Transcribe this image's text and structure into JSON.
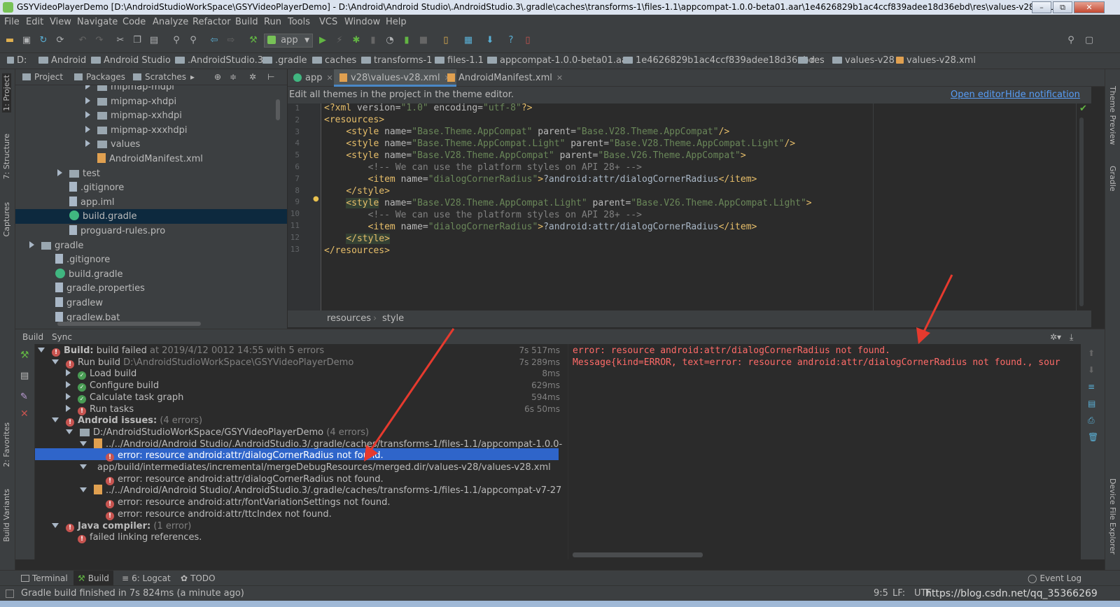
{
  "window": {
    "title": "GSYVideoPlayerDemo [D:\\AndroidStudioWorkSpace\\GSYVideoPlayerDemo] - D:\\Android\\Android Studio\\.AndroidStudio.3\\.gradle\\caches\\transforms-1\\files-1.1\\appcompat-1.0.0-beta01.aar\\1e4626829b1ac4ccf839adee18d36ebd\\res\\values-v28\\values...",
    "minimize": "–",
    "maximize": "⧉",
    "close": "✕"
  },
  "menu": [
    "File",
    "Edit",
    "View",
    "Navigate",
    "Code",
    "Analyze",
    "Refactor",
    "Build",
    "Run",
    "Tools",
    "VCS",
    "Window",
    "Help"
  ],
  "toolbar": {
    "run_config": "app"
  },
  "breadcrumb": [
    "D:",
    "Android",
    "Android Studio",
    ".AndroidStudio.3",
    ".gradle",
    "caches",
    "transforms-1",
    "files-1.1",
    "appcompat-1.0.0-beta01.aar",
    "1e4626829b1ac4ccf839adee18d36ebd",
    "res",
    "values-v28",
    "values-v28.xml"
  ],
  "left_strip": [
    "1: Project",
    "7: Structure",
    "Captures",
    "2: Favorites",
    "Build Variants"
  ],
  "right_strip": [
    "Theme Preview",
    "Gradle",
    "Device File Explorer"
  ],
  "project_panel": {
    "tabs": [
      "Project",
      "Packages",
      "Scratches"
    ],
    "tree": [
      {
        "label": "mipmap-mdpi",
        "indent": 5,
        "kind": "folder",
        "arrow": true
      },
      {
        "label": "mipmap-xhdpi",
        "indent": 5,
        "kind": "folder",
        "arrow": true
      },
      {
        "label": "mipmap-xxhdpi",
        "indent": 5,
        "kind": "folder",
        "arrow": true
      },
      {
        "label": "mipmap-xxxhdpi",
        "indent": 5,
        "kind": "folder",
        "arrow": true
      },
      {
        "label": "values",
        "indent": 5,
        "kind": "folder",
        "arrow": true
      },
      {
        "label": "AndroidManifest.xml",
        "indent": 5,
        "kind": "xml",
        "arrow": false
      },
      {
        "label": "test",
        "indent": 3,
        "kind": "folder",
        "arrow": true
      },
      {
        "label": ".gitignore",
        "indent": 3,
        "kind": "file",
        "arrow": false
      },
      {
        "label": "app.iml",
        "indent": 3,
        "kind": "file",
        "arrow": false
      },
      {
        "label": "build.gradle",
        "indent": 3,
        "kind": "gradle",
        "arrow": false
      },
      {
        "label": "proguard-rules.pro",
        "indent": 3,
        "kind": "file",
        "arrow": false
      },
      {
        "label": "gradle",
        "indent": 1,
        "kind": "folder",
        "arrow": true
      },
      {
        "label": ".gitignore",
        "indent": 2,
        "kind": "file",
        "arrow": false
      },
      {
        "label": "build.gradle",
        "indent": 2,
        "kind": "gradle",
        "arrow": false
      },
      {
        "label": "gradle.properties",
        "indent": 2,
        "kind": "file",
        "arrow": false
      },
      {
        "label": "gradlew",
        "indent": 2,
        "kind": "file",
        "arrow": false
      },
      {
        "label": "gradlew.bat",
        "indent": 2,
        "kind": "file",
        "arrow": false
      }
    ],
    "selected_index": 9
  },
  "editor": {
    "tabs": [
      {
        "label": "app",
        "active": false
      },
      {
        "label": "v28\\values-v28.xml",
        "active": true
      },
      {
        "label": "AndroidManifest.xml",
        "active": false
      }
    ],
    "notification": "Edit all themes in the project in the theme editor.",
    "open_editor": "Open editor",
    "hide_notification": "Hide notification",
    "line_numbers": [
      "1",
      "2",
      "3",
      "4",
      "5",
      "6",
      "7",
      "8",
      "9",
      "10",
      "11",
      "12",
      "13"
    ],
    "breadcrumb": [
      "resources",
      "style"
    ]
  },
  "build_panel": {
    "tabs": [
      "Build",
      "Sync"
    ],
    "rows": [
      {
        "text": "Build:",
        "extra": " build failed",
        "note": "  at 2019/4/12 0012 14:55   with 5 errors",
        "dur": "7s 517ms",
        "indent": 0,
        "icon": "err",
        "tri": "down",
        "bold": true
      },
      {
        "text": "Run build",
        "extra": "",
        "note": " D:\\AndroidStudioWorkSpace\\GSYVideoPlayerDemo",
        "dur": "7s 289ms",
        "indent": 1,
        "icon": "err",
        "tri": "down",
        "bold": false
      },
      {
        "text": "Load build",
        "extra": "",
        "note": "",
        "dur": "8ms",
        "indent": 2,
        "icon": "ok",
        "tri": "right",
        "bold": false
      },
      {
        "text": "Configure build",
        "extra": "",
        "note": "",
        "dur": "629ms",
        "indent": 2,
        "icon": "ok",
        "tri": "right",
        "bold": false
      },
      {
        "text": "Calculate task graph",
        "extra": "",
        "note": "",
        "dur": "594ms",
        "indent": 2,
        "icon": "ok",
        "tri": "right",
        "bold": false
      },
      {
        "text": "Run tasks",
        "extra": "",
        "note": "",
        "dur": "6s 50ms",
        "indent": 2,
        "icon": "err",
        "tri": "right",
        "bold": false
      },
      {
        "text": "Android issues:",
        "extra": "",
        "note": "  (4 errors)",
        "dur": "",
        "indent": 1,
        "icon": "err",
        "tri": "down",
        "bold": true
      },
      {
        "text": "D:/AndroidStudioWorkSpace/GSYVideoPlayerDemo",
        "extra": "",
        "note": "  (4 errors)",
        "dur": "",
        "indent": 2,
        "icon": "folder",
        "tri": "down",
        "bold": false
      },
      {
        "text": "../../Android/Android Studio/.AndroidStudio.3/.gradle/caches/transforms-1/files-1.1/appcompat-1.0.0-",
        "extra": "",
        "note": "",
        "dur": "",
        "indent": 3,
        "icon": "file",
        "tri": "down",
        "bold": false
      },
      {
        "text": "error: resource android:attr/dialogCornerRadius not found.",
        "extra": "",
        "note": "",
        "dur": "",
        "indent": 4,
        "icon": "err",
        "tri": "none",
        "bold": false
      },
      {
        "text": "app/build/intermediates/incremental/mergeDebugResources/merged.dir/values-v28/values-v28.xml",
        "extra": "",
        "note": "",
        "dur": "",
        "indent": 3,
        "icon": "none",
        "tri": "down",
        "bold": false
      },
      {
        "text": "error: resource android:attr/dialogCornerRadius not found.",
        "extra": "",
        "note": "",
        "dur": "",
        "indent": 4,
        "icon": "err",
        "tri": "none",
        "bold": false
      },
      {
        "text": "../../Android/Android Studio/.AndroidStudio.3/.gradle/caches/transforms-1/files-1.1/appcompat-v7-27",
        "extra": "",
        "note": "",
        "dur": "",
        "indent": 3,
        "icon": "file",
        "tri": "down",
        "bold": false
      },
      {
        "text": "error: resource android:attr/fontVariationSettings not found.",
        "extra": "",
        "note": "",
        "dur": "",
        "indent": 4,
        "icon": "err",
        "tri": "none",
        "bold": false
      },
      {
        "text": "error: resource android:attr/ttcIndex not found.",
        "extra": "",
        "note": "",
        "dur": "",
        "indent": 4,
        "icon": "err",
        "tri": "none",
        "bold": false
      },
      {
        "text": "Java compiler:",
        "extra": "",
        "note": "  (1 error)",
        "dur": "",
        "indent": 1,
        "icon": "err",
        "tri": "down",
        "bold": true
      },
      {
        "text": "failed linking references.",
        "extra": "",
        "note": "",
        "dur": "",
        "indent": 2,
        "icon": "err",
        "tri": "none",
        "bold": false
      }
    ],
    "selected_index": 9,
    "output": [
      "error: resource android:attr/dialogCornerRadius not found.",
      "Message{kind=ERROR, text=error: resource android:attr/dialogCornerRadius not found., sour"
    ]
  },
  "bottom_tabs": {
    "terminal": "Terminal",
    "build": "Build",
    "logcat": "6: Logcat",
    "todo": "TODO",
    "event_log": "Event Log"
  },
  "status": {
    "message": "Gradle build finished in 7s 824ms (a minute ago)",
    "position": "9:5",
    "line_sep": "LF:",
    "encoding": "UTF",
    "watermark": "https://blog.csdn.net/qq_35366269"
  },
  "colors": {
    "ide_bg": "#2b2b2b",
    "panel_bg": "#3c3f41",
    "selection": "#2f65ca",
    "error_text": "#ff6b68",
    "annotation_arrow": "#e63a2e"
  }
}
